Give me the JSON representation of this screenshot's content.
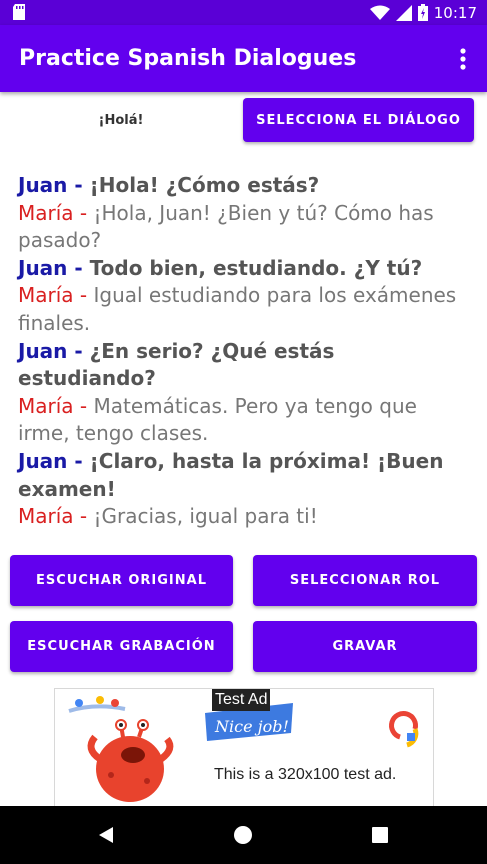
{
  "status_bar": {
    "time": "10:17"
  },
  "app_bar": {
    "title": "Practice Spanish Dialogues",
    "overflow_icon": "more-vert-icon"
  },
  "tabs": {
    "active_label": "¡Holá!",
    "select_dialog_label": "SELECCIONA EL DIÁLOGO"
  },
  "dialogue": [
    {
      "speaker": "Juan",
      "text": "¡Hola! ¿Cómo estás?"
    },
    {
      "speaker": "María",
      "text": "¡Hola, Juan! ¿Bien y tú? Cómo has pasado?"
    },
    {
      "speaker": "Juan",
      "text": "Todo bien, estudiando. ¿Y tú?"
    },
    {
      "speaker": "María",
      "text": "Igual estudiando para los exámenes finales."
    },
    {
      "speaker": "Juan",
      "text": "¿En serio? ¿Qué estás estudiando?"
    },
    {
      "speaker": "María",
      "text": "Matemáticas. Pero ya tengo que irme, tengo clases."
    },
    {
      "speaker": "Juan",
      "text": "¡Claro, hasta la próxima! ¡Buen examen!"
    },
    {
      "speaker": "María",
      "text": "¡Gracias, igual para ti!"
    }
  ],
  "buttons": {
    "listen_original": "ESCUCHAR ORIGINAL",
    "select_role": "SELECCIONAR ROL",
    "listen_recording": "ESCUCHAR GRABACIÓN",
    "record": "GRAVAR"
  },
  "ad": {
    "label": "Test Ad",
    "banner_text": "Nice job!",
    "description": "This is a 320x100 test ad."
  },
  "colors": {
    "primary": "#6200ee",
    "status_bar": "#5a00d6",
    "juan": "#1a1aa6",
    "maria": "#d92020"
  }
}
